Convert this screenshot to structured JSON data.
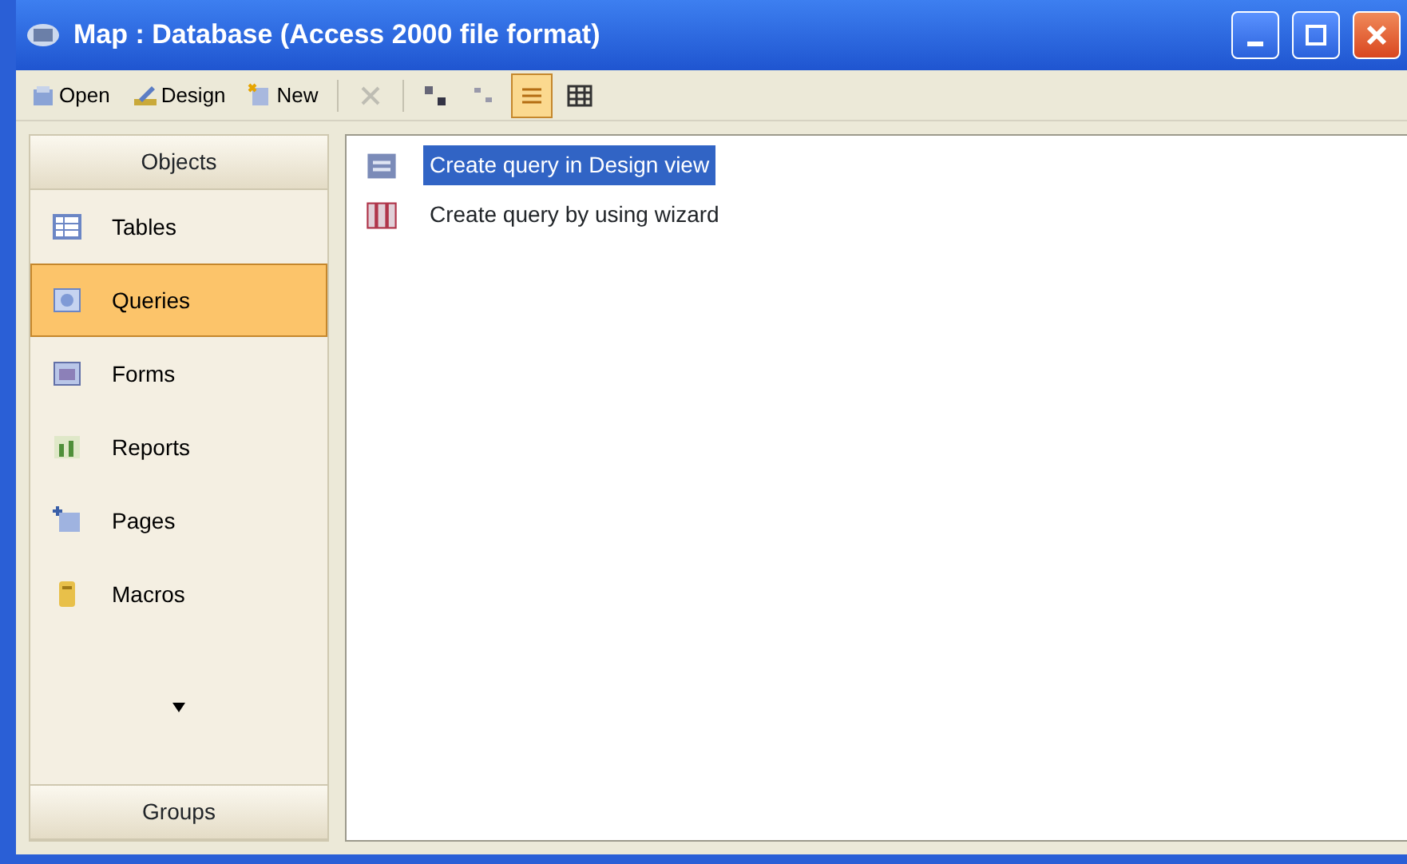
{
  "window": {
    "title": "Map : Database (Access 2000 file format)"
  },
  "toolbar": [
    {
      "kind": "open",
      "label": "Open",
      "disabled": false,
      "selected": false
    },
    {
      "kind": "design",
      "label": "Design",
      "disabled": false,
      "selected": false
    },
    {
      "kind": "new",
      "label": "New",
      "disabled": false,
      "selected": false
    },
    {
      "kind": "delete",
      "disabled": true,
      "selected": false
    },
    {
      "kind": "large-icons",
      "disabled": false,
      "selected": false
    },
    {
      "kind": "small-icons",
      "disabled": false,
      "selected": false
    },
    {
      "kind": "list",
      "disabled": false,
      "selected": true
    },
    {
      "kind": "details",
      "disabled": false,
      "selected": false
    }
  ],
  "sidebar": {
    "header": "Objects",
    "items": [
      {
        "kind": "tables",
        "label": "Tables",
        "selected": false
      },
      {
        "kind": "queries",
        "label": "Queries",
        "selected": true
      },
      {
        "kind": "forms",
        "label": "Forms",
        "selected": false
      },
      {
        "kind": "reports",
        "label": "Reports",
        "selected": false
      },
      {
        "kind": "pages",
        "label": "Pages",
        "selected": false
      },
      {
        "kind": "macros",
        "label": "Macros",
        "selected": false
      }
    ],
    "footer": "Groups"
  },
  "list": [
    {
      "kind": "design",
      "label": "Create query in Design view",
      "selected": true
    },
    {
      "kind": "wizard",
      "label": "Create query by using wizard",
      "selected": false
    }
  ]
}
